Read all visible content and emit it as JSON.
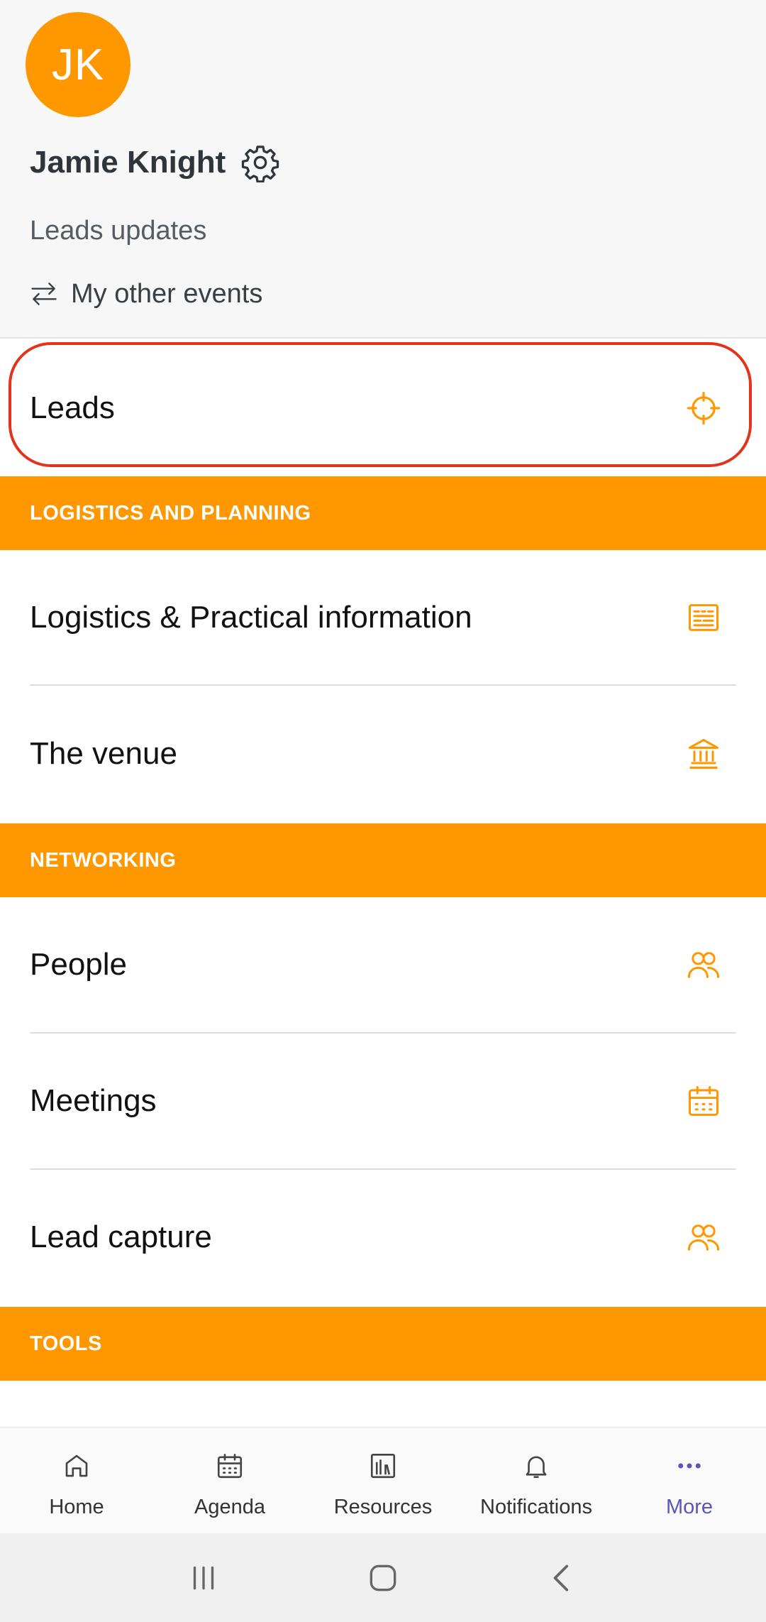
{
  "profile": {
    "initials": "JK",
    "name": "Jamie Knight",
    "links": {
      "updates": "Leads updates",
      "other_events": "My other events"
    }
  },
  "menu": {
    "leads": {
      "label": "Leads",
      "icon": "crosshair-icon"
    },
    "sections": [
      {
        "title": "LOGISTICS AND PLANNING",
        "items": [
          {
            "label": "Logistics & Practical information",
            "icon": "info-board-icon"
          },
          {
            "label": "The venue",
            "icon": "building-icon"
          }
        ]
      },
      {
        "title": "NETWORKING",
        "items": [
          {
            "label": "People",
            "icon": "people-icon"
          },
          {
            "label": "Meetings",
            "icon": "calendar-icon"
          },
          {
            "label": "Lead capture",
            "icon": "people-icon"
          }
        ]
      },
      {
        "title": "TOOLS",
        "items": []
      }
    ]
  },
  "bottom_nav": {
    "items": [
      {
        "label": "Home",
        "icon": "home-icon"
      },
      {
        "label": "Agenda",
        "icon": "calendar-icon"
      },
      {
        "label": "Resources",
        "icon": "library-icon"
      },
      {
        "label": "Notifications",
        "icon": "bell-icon"
      },
      {
        "label": "More",
        "icon": "more-dots-icon"
      }
    ],
    "active": "More"
  },
  "colors": {
    "accent": "#ff9800",
    "active_nav": "#5a55b6",
    "highlight": "#e3331d"
  }
}
